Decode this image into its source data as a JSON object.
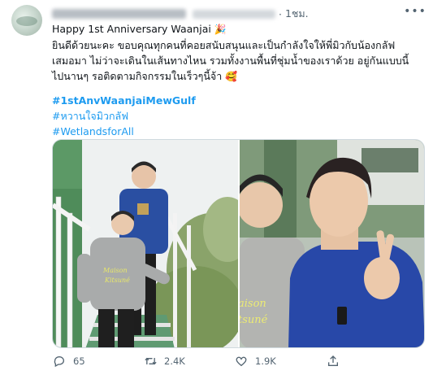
{
  "tweet": {
    "time": "1ชม.",
    "more_label": "•••",
    "lines": [
      "Happy 1st Anniversary Waanjai",
      "ยินดีด้วยนะคะ ขอบคุณทุกคนที่คอยสนับสนุนและเป็นกำลังใจให้พี่มิวกับน้องกลัฟ",
      "เสมอมา ไม่ว่าจะเดินในเส้นทางไหน รวมทั้งงานพื้นที่ชุ่มน้ำของเราด้วย อยู่กันแบบนี้",
      "ไปนานๆ รอติดตามกิจกรรมในเร็วๆนี้จ้า"
    ],
    "emoji_1": "🎉",
    "emoji_2": "🥰",
    "hashtags": [
      "#1stAnvWaanjaiMewGulf",
      "#หวานใจมิวกลัฟ",
      "#WetlandsforAll"
    ],
    "photo_shirt_text": [
      "Maison",
      "Kitsuné"
    ],
    "photo_right_shirt_text": [
      "aison",
      "tsuné"
    ]
  },
  "actions": {
    "replies": "65",
    "retweets": "2.4K",
    "likes": "1.9K"
  },
  "colors": {
    "link": "#1d9bf0",
    "muted": "#536471",
    "border": "#cfd9de"
  }
}
